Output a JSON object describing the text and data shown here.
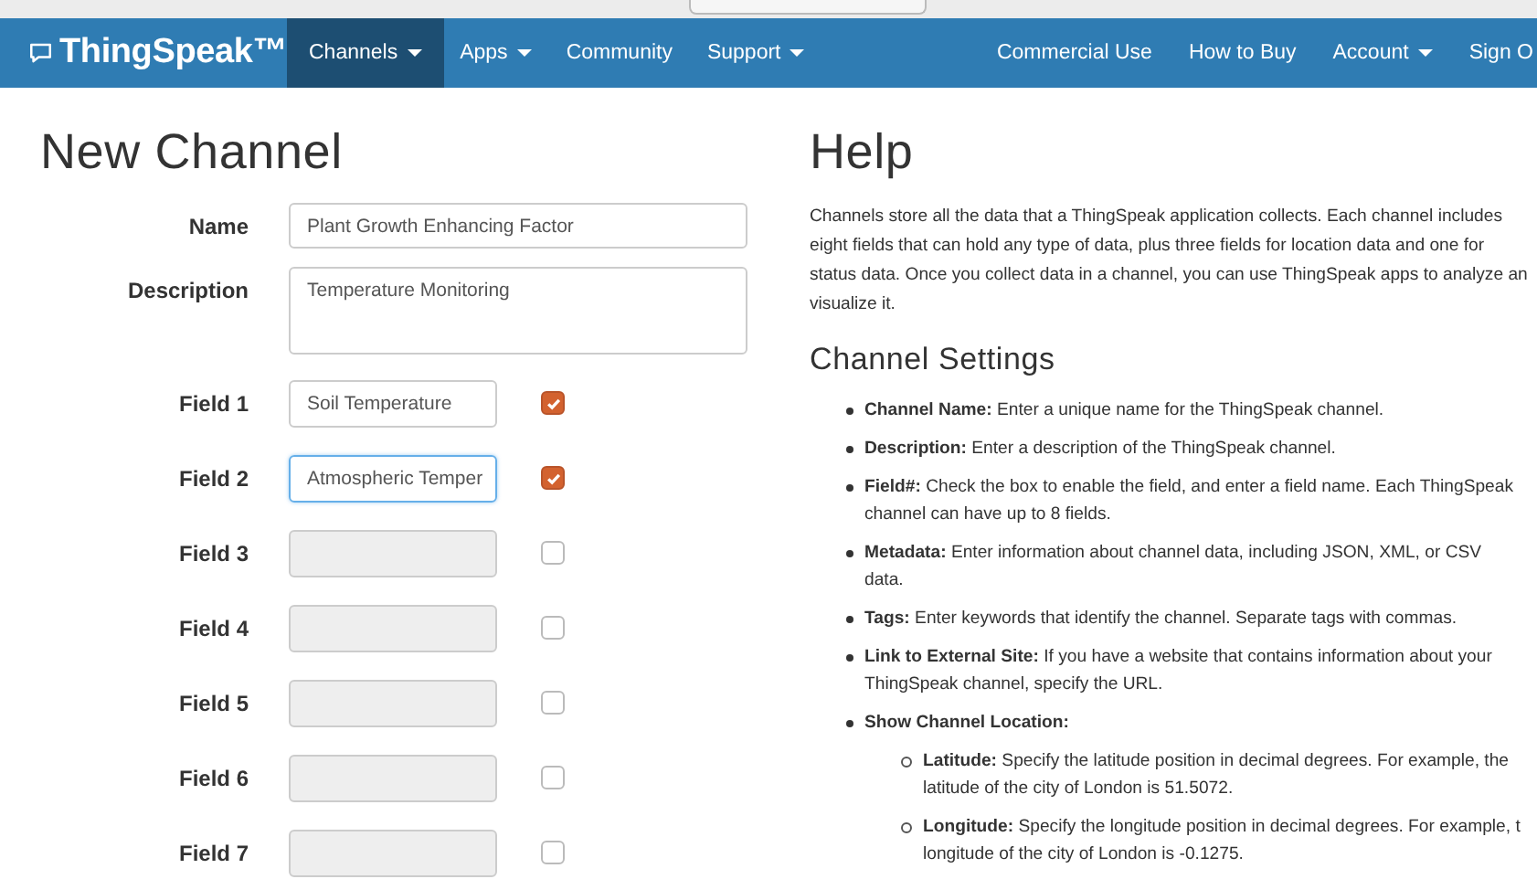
{
  "nav": {
    "logo": "ThingSpeak™",
    "items": [
      {
        "label": "Channels",
        "dropdown": true,
        "selected": true
      },
      {
        "label": "Apps",
        "dropdown": true,
        "selected": false
      },
      {
        "label": "Community",
        "dropdown": false,
        "selected": false
      },
      {
        "label": "Support",
        "dropdown": true,
        "selected": false
      }
    ],
    "right_items": [
      {
        "label": "Commercial Use",
        "dropdown": false
      },
      {
        "label": "How to Buy",
        "dropdown": false
      },
      {
        "label": "Account",
        "dropdown": true
      },
      {
        "label": "Sign O",
        "dropdown": false
      }
    ]
  },
  "form": {
    "title": "New Channel",
    "name": {
      "label": "Name",
      "value": "Plant Growth Enhancing Factor"
    },
    "description": {
      "label": "Description",
      "value": "Temperature Monitoring"
    },
    "fields": [
      {
        "label": "Field 1",
        "value": "Soil Temperature",
        "checked": true,
        "disabled": false,
        "focused": false
      },
      {
        "label": "Field 2",
        "value": "Atmospheric Temper",
        "checked": true,
        "disabled": false,
        "focused": true
      },
      {
        "label": "Field 3",
        "checked": false,
        "disabled": true,
        "focused": false
      },
      {
        "label": "Field 4",
        "checked": false,
        "disabled": true,
        "focused": false
      },
      {
        "label": "Field 5",
        "checked": false,
        "disabled": true,
        "focused": false
      },
      {
        "label": "Field 6",
        "checked": false,
        "disabled": true,
        "focused": false
      },
      {
        "label": "Field 7",
        "checked": false,
        "disabled": true,
        "focused": false
      }
    ]
  },
  "help": {
    "title": "Help",
    "intro": "Channels store all the data that a ThingSpeak application collects. Each channel includes eight fields that can hold any type of data, plus three fields for location data and one for status data. Once you collect data in a channel, you can use ThingSpeak apps to analyze an visualize it.",
    "section_title": "Channel Settings",
    "items": [
      {
        "text": "**Channel Name:** Enter a unique name for the ThingSpeak channel."
      },
      {
        "text": "**Description:** Enter a description of the ThingSpeak channel."
      },
      {
        "text": "**Field#:** Check the box to enable the field, and enter a field name. Each ThingSpeak channel can have up to 8 fields."
      },
      {
        "text": "**Metadata:** Enter information about channel data, including JSON, XML, or CSV data."
      },
      {
        "text": "**Tags:** Enter keywords that identify the channel. Separate tags with commas."
      },
      {
        "text": "**Link to External Site:** If you have a website that contains information about your ThingSpeak channel, specify the URL."
      },
      {
        "text": "**Show Channel Location:**",
        "children": [
          {
            "text": "**Latitude:** Specify the latitude position in decimal degrees. For example, the latitude of the city of London is 51.5072."
          },
          {
            "text": "**Longitude:** Specify the longitude position in decimal degrees. For example, t longitude of the city of London is -0.1275."
          }
        ]
      }
    ]
  }
}
